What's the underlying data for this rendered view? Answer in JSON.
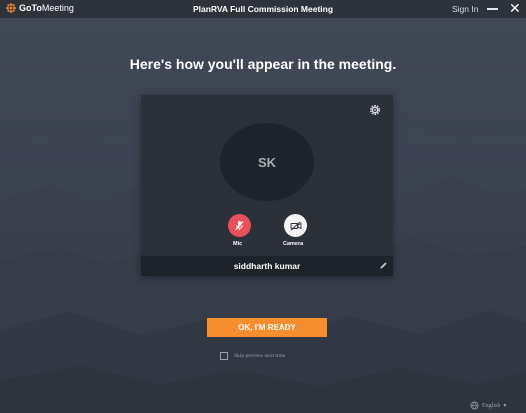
{
  "app": {
    "logo_text_prefix": "GoTo",
    "logo_text_suffix": "Meeting",
    "window_title": "PlanRVA Full Commission Meeting",
    "sign_in_label": "Sign In",
    "accent_color": "#f68d2e"
  },
  "main": {
    "heading": "Here's how you'll appear in the meeting."
  },
  "preview": {
    "avatar_initials": "SK",
    "mic_label": "Mic",
    "camera_label": "Camera",
    "mic_state": "muted",
    "camera_state": "off",
    "display_name": "siddharth kumar",
    "mic_color": "#e8505b"
  },
  "actions": {
    "ready_label": "OK, I'M READY",
    "skip_label": "Skip preview next time",
    "skip_checked": false
  },
  "footer": {
    "language_label": "English"
  },
  "icons": {
    "gear": "gear-icon",
    "mic": "mic-muted-icon",
    "camera": "camera-off-icon",
    "pencil": "pencil-icon",
    "globe": "globe-icon"
  }
}
